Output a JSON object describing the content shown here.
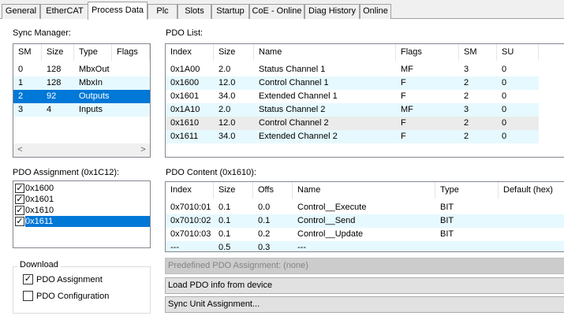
{
  "tabs": [
    {
      "label": "General",
      "active": false
    },
    {
      "label": "EtherCAT",
      "active": false
    },
    {
      "label": "Process Data",
      "active": true
    },
    {
      "label": "Plc",
      "active": false
    },
    {
      "label": "Slots",
      "active": false
    },
    {
      "label": "Startup",
      "active": false
    },
    {
      "label": "CoE - Online",
      "active": false
    },
    {
      "label": "Diag History",
      "active": false
    },
    {
      "label": "Online",
      "active": false
    }
  ],
  "sync_manager": {
    "title": "Sync Manager:",
    "columns": [
      "SM",
      "Size",
      "Type",
      "Flags"
    ],
    "rows": [
      [
        "0",
        "128",
        "MbxOut",
        ""
      ],
      [
        "1",
        "128",
        "MbxIn",
        ""
      ],
      [
        "2",
        "92",
        "Outputs",
        ""
      ],
      [
        "3",
        "4",
        "Inputs",
        ""
      ]
    ],
    "selected_row": 2,
    "scroll_left_glyph": "<",
    "scroll_right_glyph": ">"
  },
  "pdo_list": {
    "title": "PDO List:",
    "columns": [
      "Index",
      "Size",
      "Name",
      "Flags",
      "SM",
      "SU"
    ],
    "rows": [
      [
        "0x1A00",
        "2.0",
        "Status Channel 1",
        "MF",
        "3",
        "0"
      ],
      [
        "0x1600",
        "12.0",
        "Control Channel 1",
        "F",
        "2",
        "0"
      ],
      [
        "0x1601",
        "34.0",
        "Extended Channel 1",
        "F",
        "2",
        "0"
      ],
      [
        "0x1A10",
        "2.0",
        "Status Channel 2",
        "MF",
        "3",
        "0"
      ],
      [
        "0x1610",
        "12.0",
        "Control Channel 2",
        "F",
        "2",
        "0"
      ],
      [
        "0x1611",
        "34.0",
        "Extended Channel 2",
        "F",
        "2",
        "0"
      ]
    ]
  },
  "pdo_assignment": {
    "title": "PDO Assignment (0x1C12):",
    "items": [
      {
        "label": "0x1600",
        "checked": true
      },
      {
        "label": "0x1601",
        "checked": true
      },
      {
        "label": "0x1610",
        "checked": true
      },
      {
        "label": "0x1611",
        "checked": true
      }
    ],
    "selected_item": 3
  },
  "pdo_content": {
    "title": "PDO Content (0x1610):",
    "columns": [
      "Index",
      "Size",
      "Offs",
      "Name",
      "Type",
      "Default (hex)"
    ],
    "rows": [
      [
        "0x7010:01",
        "0.1",
        "0.0",
        "Control__Execute",
        "BIT",
        ""
      ],
      [
        "0x7010:02",
        "0.1",
        "0.1",
        "Control__Send",
        "BIT",
        ""
      ],
      [
        "0x7010:03",
        "0.1",
        "0.2",
        "Control__Update",
        "BIT",
        ""
      ],
      [
        "---",
        "0.5",
        "0.3",
        "---",
        "",
        ""
      ]
    ]
  },
  "download": {
    "title": "Download",
    "options": [
      {
        "label": "PDO Assignment",
        "checked": true
      },
      {
        "label": "PDO Configuration",
        "checked": false
      }
    ]
  },
  "buttons": {
    "predefined": "Predefined PDO Assignment: (none)",
    "load_pdo": "Load PDO info from device",
    "sync_unit": "Sync Unit Assignment..."
  },
  "check_glyph": "✓",
  "colors": {
    "selection": "#0078d7",
    "alt_row": "#e6f9fe",
    "gray_row": "#ebebeb"
  }
}
